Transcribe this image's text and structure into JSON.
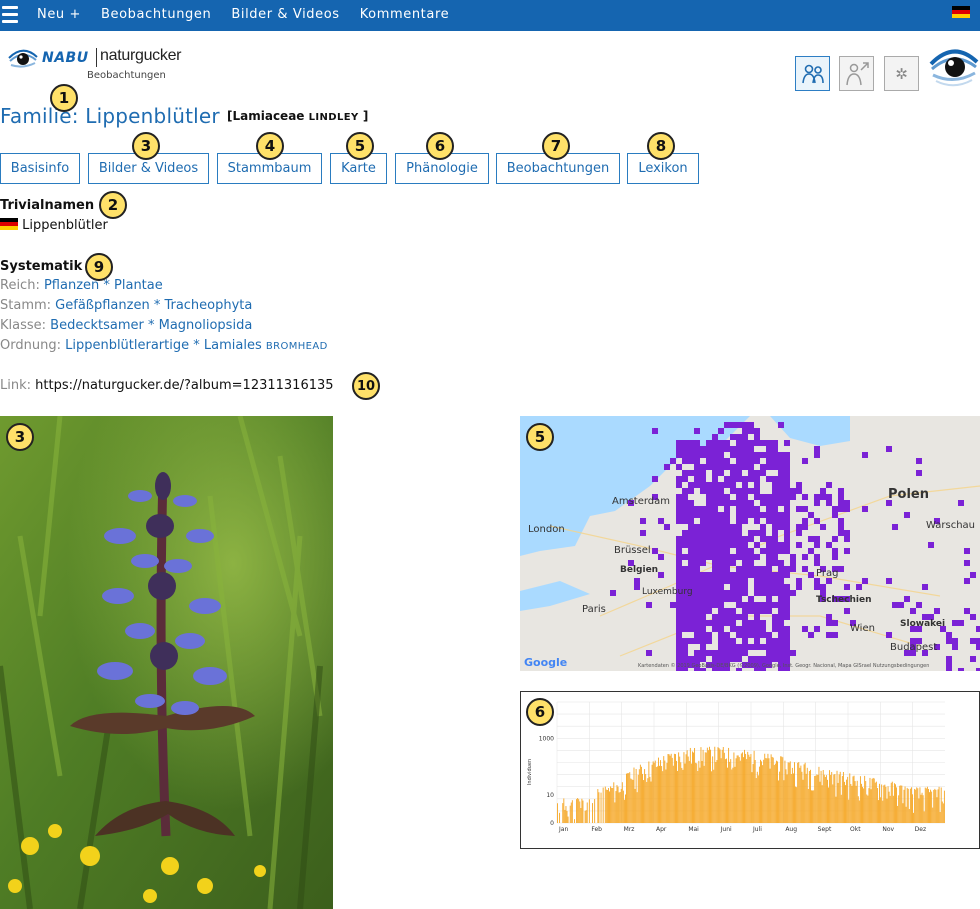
{
  "topbar": {
    "nav": [
      "Neu +",
      "Beobachtungen",
      "Bilder & Videos",
      "Kommentare"
    ],
    "language_icon": "german-flag-icon",
    "color": "#1565b0"
  },
  "logo": {
    "brand": "NABU",
    "name": "naturgucker",
    "subtitle": "Beobachtungen"
  },
  "header_icons": [
    "people-icon",
    "gender-icon",
    "settings-icon"
  ],
  "title": {
    "text": "Familie: Lippenblütler",
    "scientific": "[Lamiaceae",
    "author": "Lindley",
    "close": "]"
  },
  "tabs": [
    "Basisinfo",
    "Bilder & Videos",
    "Stammbaum",
    "Karte",
    "Phänologie",
    "Beobachtungen",
    "Lexikon"
  ],
  "trivialnamen": {
    "heading": "Trivialnamen",
    "names": [
      "Lippenblütler"
    ]
  },
  "systematik": {
    "heading": "Systematik",
    "rows": [
      {
        "label": "Reich:",
        "value": "Pflanzen * Plantae",
        "author": ""
      },
      {
        "label": "Stamm:",
        "value": "Gefäßpflanzen * Tracheophyta",
        "author": ""
      },
      {
        "label": "Klasse:",
        "value": "Bedecktsamer * Magnoliopsida",
        "author": ""
      },
      {
        "label": "Ordnung:",
        "value": "Lippenblütlerartige * Lamiales",
        "author": "Bromhead"
      }
    ]
  },
  "link": {
    "label": "Link:",
    "url": "https://naturgucker.de/?album=12311316135"
  },
  "badges": [
    "1",
    "2",
    "3",
    "4",
    "5",
    "6",
    "7",
    "8",
    "9",
    "10",
    "3",
    "5",
    "6"
  ],
  "map": {
    "labels": [
      "Amsterdam",
      "London",
      "Brüssel",
      "Belgien",
      "Luxemburg",
      "Paris",
      "Polen",
      "Warschau",
      "Prag",
      "Tschechien",
      "Wien",
      "Slowakei",
      "Budapest"
    ],
    "google": "Google",
    "footer": "Kartendaten © 2019 GeoBasis-DE/BKG (©2009), Google, Inst. Geogr. Nacional, Mapa GISrael   Nutzungsbedingungen",
    "occurrence_color": "#7b22d6"
  },
  "chart_data": {
    "type": "bar",
    "ylabel": "Individuen",
    "yticks": [
      "0",
      "10",
      "1000"
    ],
    "y_scale": "log",
    "months": [
      "Jan",
      "Feb",
      "Mrz",
      "Apr",
      "Mai",
      "Juni",
      "Juli",
      "Aug",
      "Sept",
      "Okt",
      "Nov",
      "Dez"
    ],
    "bar_color": "#f5a623",
    "monthly_typical_individuals": [
      3,
      4,
      15,
      80,
      200,
      220,
      160,
      90,
      45,
      25,
      15,
      8
    ]
  }
}
